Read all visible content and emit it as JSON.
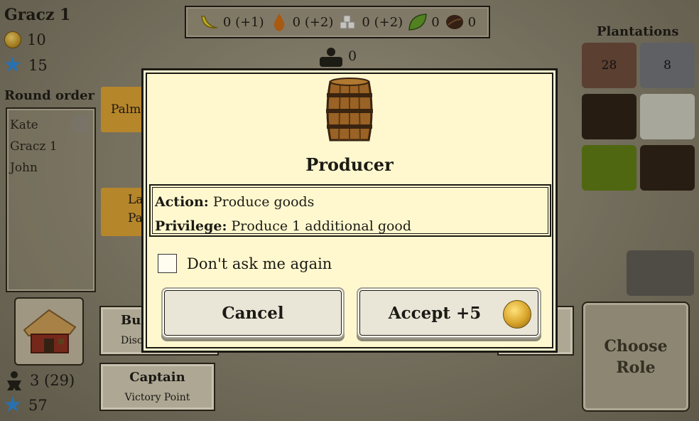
{
  "player": {
    "name": "Gracz 1",
    "coins": "10",
    "vp": "15",
    "colonists": "3 (29)",
    "total_vp": "57"
  },
  "round_order": {
    "title": "Round order",
    "players": [
      "Kate",
      "Gracz 1",
      "John"
    ]
  },
  "resources": [
    {
      "icon": "banana-icon",
      "value": "0 (+1)"
    },
    {
      "icon": "drop-icon",
      "value": "0 (+2)"
    },
    {
      "icon": "sugar-icon",
      "value": "0 (+2)"
    },
    {
      "icon": "leaf-icon",
      "value": "0"
    },
    {
      "icon": "coffee-bean-icon",
      "value": "0"
    }
  ],
  "colonist_ship_count": "0",
  "plantations": {
    "title": "Plantations",
    "tiles": [
      {
        "label": "28",
        "color": "#6b4a3a"
      },
      {
        "label": "8",
        "color": "#6f7278"
      },
      {
        "label": "",
        "color": "#2a1f14"
      },
      {
        "label": "",
        "color": "#c8c8bc"
      },
      {
        "label": "",
        "color": "#5c7a12"
      },
      {
        "label": "",
        "color": "#2d2014"
      }
    ]
  },
  "background_cards": {
    "card1": "Palm",
    "card2_line1": "Lar",
    "card2_line2": "Palm",
    "builder_partial": "Bui",
    "builder_sub_partial": "Disc",
    "captain_name": "Captain",
    "captain_sub": "Victory Point"
  },
  "choose_role": "Choose Role",
  "modal": {
    "title": "Producer",
    "action_label": "Action:",
    "action_text": " Produce goods",
    "privilege_label": "Privilege:",
    "privilege_text": " Produce 1 additional good",
    "checkbox_label": "Don't ask me again",
    "cancel_label": "Cancel",
    "accept_label": "Accept +5"
  }
}
